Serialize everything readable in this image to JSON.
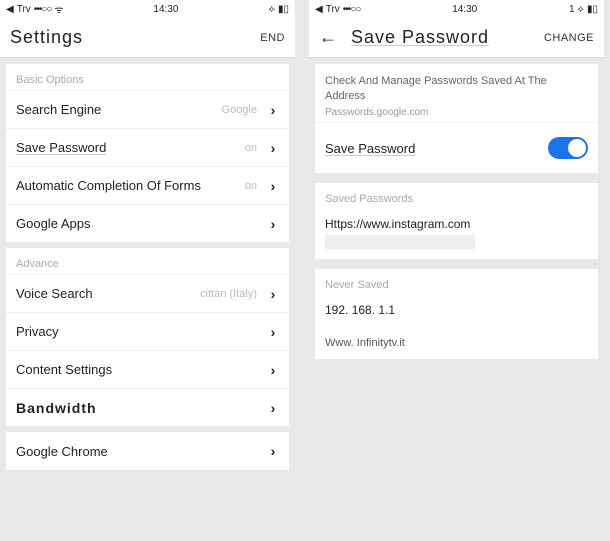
{
  "left": {
    "status": {
      "carrier": "Trv",
      "dots": "•••○○",
      "wifi": "ᯤ",
      "time": "14:30",
      "bt": "⟡",
      "batt": "▮▯"
    },
    "header": {
      "title": "Settings",
      "action": "END"
    },
    "basic": {
      "header": "Basic Options",
      "search_engine": {
        "label": "Search Engine",
        "value": "Google"
      },
      "save_password": {
        "label": "Save Password",
        "value": "on"
      },
      "autofill": {
        "label": "Automatic Completion Of Forms",
        "value": "on"
      },
      "google_apps": {
        "label": "Google Apps"
      }
    },
    "advanced": {
      "header": "Advance",
      "voice_search": {
        "label": "Voice Search",
        "value": "cittàn (Italy)"
      },
      "privacy": {
        "label": "Privacy"
      },
      "content": {
        "label": "Content Settings"
      },
      "bandwidth": {
        "label": "Bandwidth"
      }
    },
    "chrome": {
      "label": "Google Chrome"
    }
  },
  "right": {
    "status": {
      "carrier": "Trv",
      "dots": "•••○○",
      "time": "14:30",
      "bt": "⟡",
      "batt": "▮▯",
      "sig": "1 ⟡"
    },
    "header": {
      "title": "Save Password",
      "action": "CHANGE"
    },
    "desc": {
      "text": "Check And Manage Passwords Saved At The Address",
      "link": "Passwords.google.com"
    },
    "toggle": {
      "label": "Save Password",
      "on": true
    },
    "saved": {
      "header": "Saved Passwords",
      "entry": "Https://www.instagram.com"
    },
    "never": {
      "header": "Never Saved",
      "ip": "192. 168. 1.1",
      "site": "Www. Infinitytv.it"
    }
  }
}
